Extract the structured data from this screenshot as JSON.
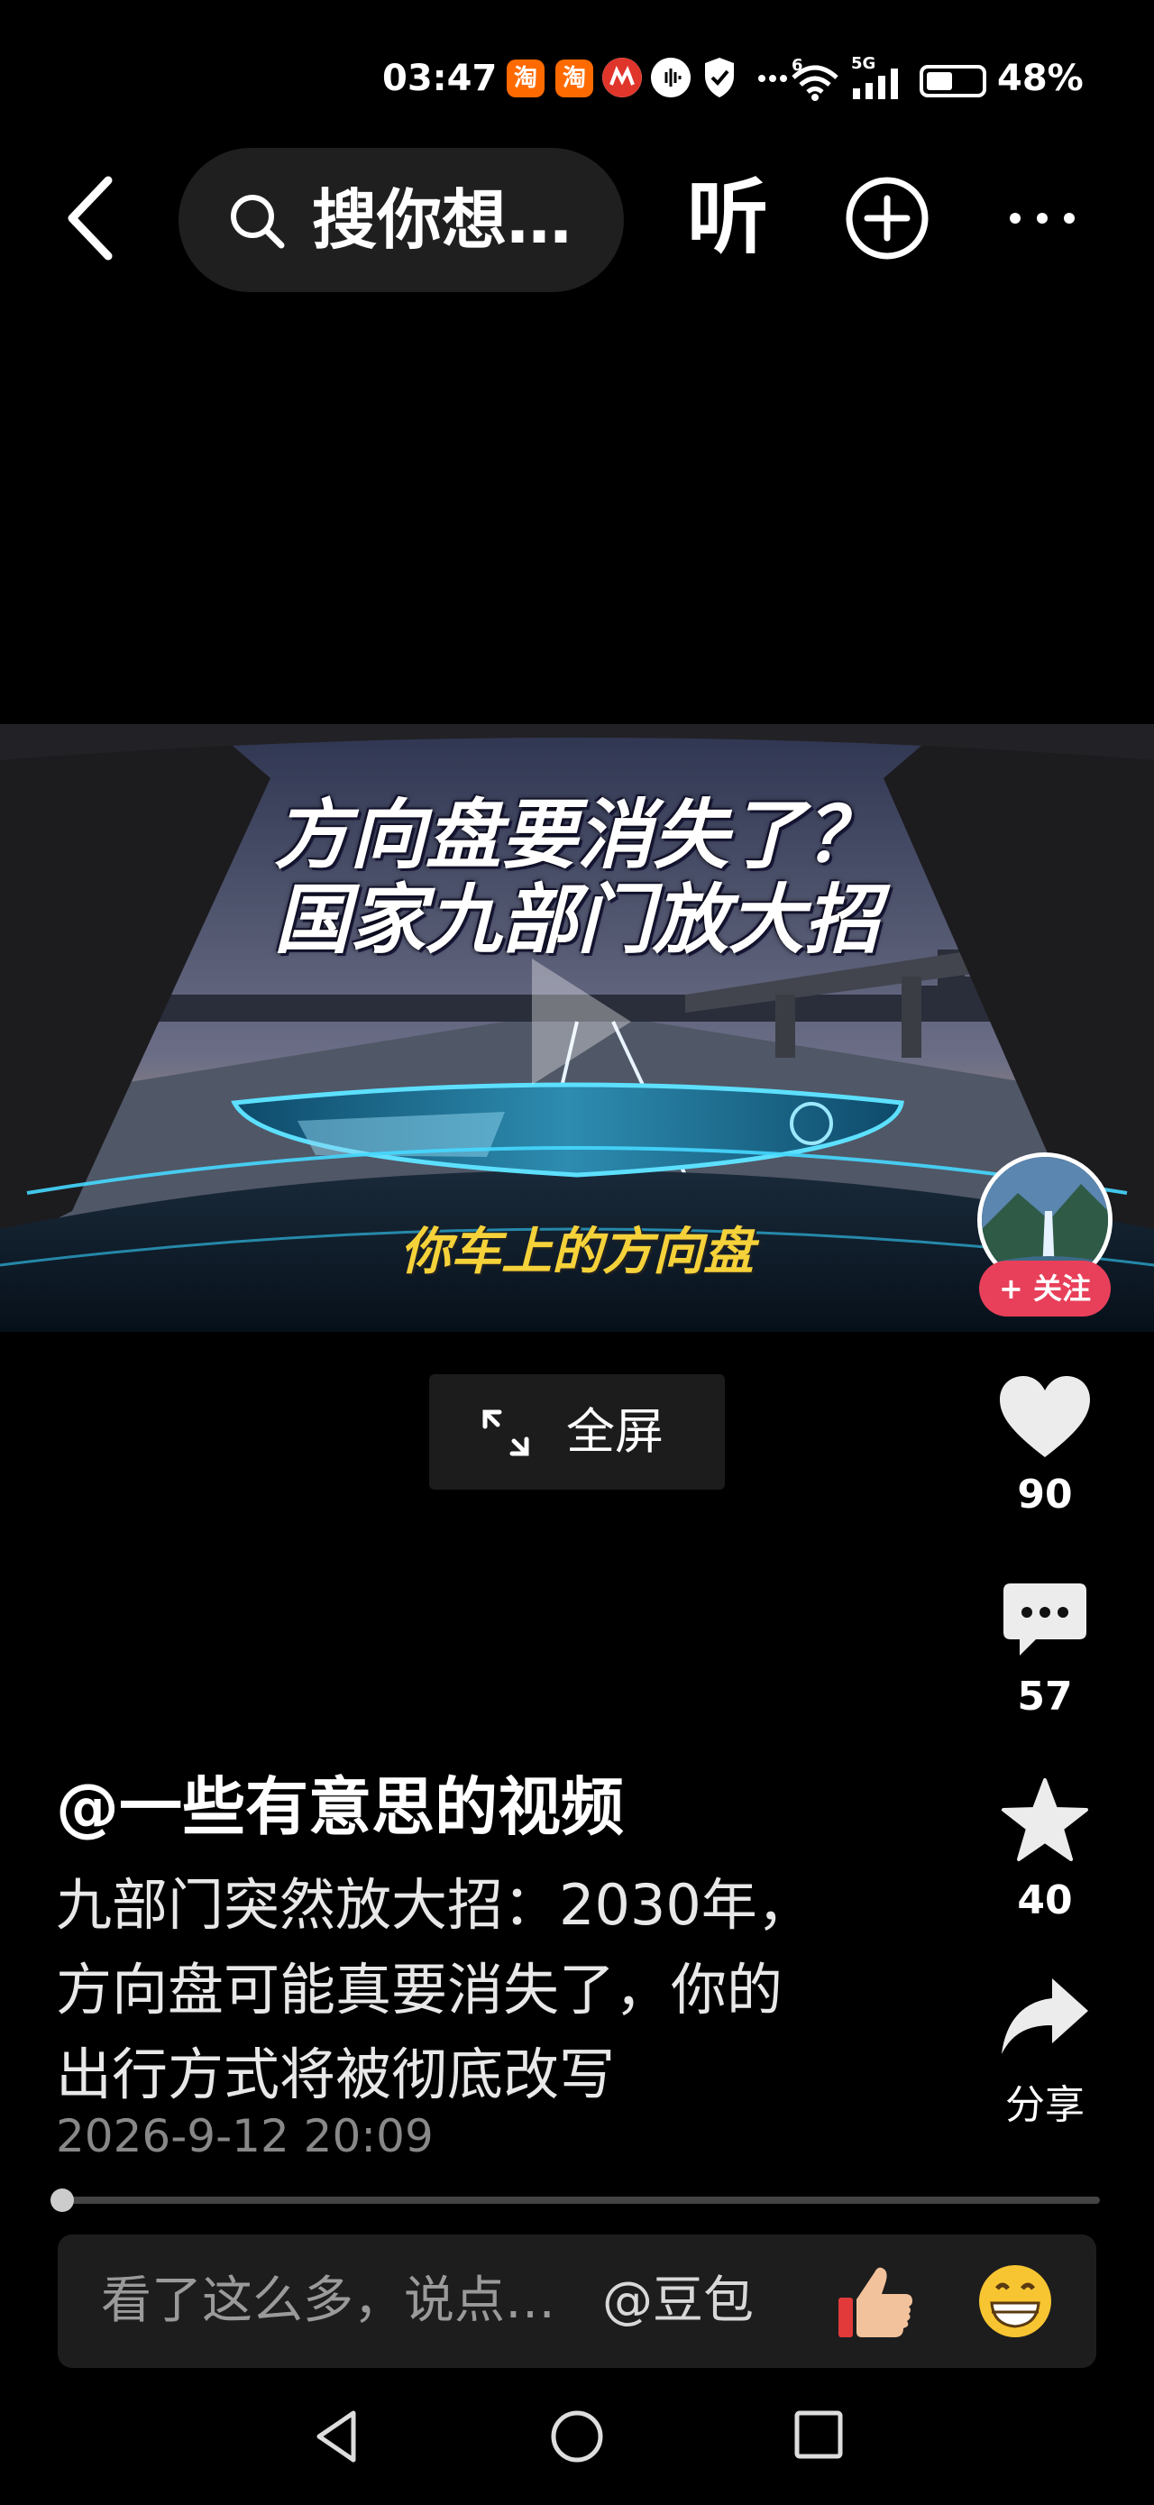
{
  "status_bar": {
    "time": "03:47",
    "app_icons": [
      "淘",
      "淘"
    ],
    "network_type": "5G",
    "network_sub": "6",
    "battery_percent": "48%",
    "battery_level": 0.48
  },
  "top_nav": {
    "search_text": "搜你想…",
    "listen_label": "听"
  },
  "video": {
    "overlay_title_1": "方向盘要消失了？",
    "overlay_title_2": "国家九部门放大招",
    "overlay_subtitle": "你车上的方向盘",
    "fullscreen_label": "全屏"
  },
  "creator": {
    "follow_label": "+ 关注"
  },
  "actions": {
    "likes": "90",
    "comments": "57",
    "favorites": "40",
    "share_label": "分享"
  },
  "post": {
    "author": "@一些有意思的视频",
    "description_lines": [
      "九部门突然放大招：2030年，",
      "方向盘可能真要消失了，你的",
      "出行方式将被彻底改写"
    ],
    "timestamp": "2026-9-12 20:09"
  },
  "progress": {
    "played_fraction": 0.0
  },
  "comment_bar": {
    "placeholder": "看了这么多，说点…",
    "mention": "@豆包"
  },
  "colors": {
    "background": "#000000",
    "follow_red": "#e8405a",
    "subtitle_yellow": "#f6d23a"
  }
}
